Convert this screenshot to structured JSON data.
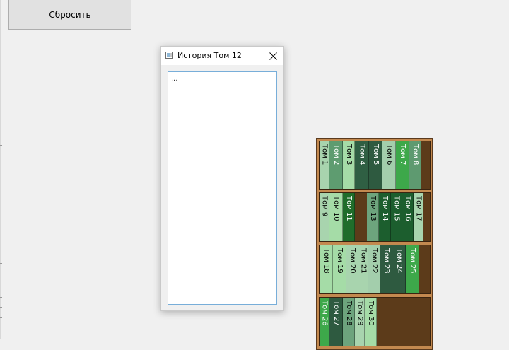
{
  "reset_button": {
    "label": "Сбросить"
  },
  "dialog": {
    "title": "История Том 12",
    "text": "..."
  },
  "colors": {
    "dark": "#2e6f47",
    "darkest": "#1c5e2e",
    "mid": "#3aa24a",
    "light": "#a5d5ad",
    "wood": "#5c3b1a",
    "frame": "#c3894f"
  },
  "shelves": [
    {
      "books": [
        {
          "label": "Том 1",
          "color": "#a8d4ae"
        },
        {
          "label": "Том 2",
          "color": "#5e9c70"
        },
        {
          "label": "Том 3",
          "color": "#a5dca7"
        },
        {
          "label": "Том 4",
          "color": "#2f5f43"
        },
        {
          "label": "Том 5",
          "color": "#2e5a40"
        },
        {
          "label": "Том 6",
          "color": "#a3ceac"
        },
        {
          "label": "Том 7",
          "color": "#3da84a"
        },
        {
          "label": "Том 8",
          "color": "#5e9a70"
        }
      ]
    },
    {
      "books": [
        {
          "label": "Том 9",
          "color": "#a8d4ae"
        },
        {
          "label": "Том 10",
          "color": "#a5dca7"
        },
        {
          "label": "Том 11",
          "color": "#1f6d2b"
        },
        {
          "label": "Том 13",
          "color": "#6da47d"
        },
        {
          "label": "Том 14",
          "color": "#1c5e2e"
        },
        {
          "label": "Том 15",
          "color": "#1c5e2e"
        },
        {
          "label": "Том 16",
          "color": "#1c5e2e"
        },
        {
          "label": "Том 17",
          "color": "#a8d4ae"
        }
      ]
    },
    {
      "books": [
        {
          "label": "Том 18",
          "color": "#a5dca7"
        },
        {
          "label": "Том 19",
          "color": "#a5dca7"
        },
        {
          "label": "Том 20",
          "color": "#a8d4ae"
        },
        {
          "label": "Том 21",
          "color": "#a8d4ae"
        },
        {
          "label": "Том 22",
          "color": "#a3ceac"
        },
        {
          "label": "Том 23",
          "color": "#2e5a40"
        },
        {
          "label": "Том 24",
          "color": "#2e5a40"
        },
        {
          "label": "Том 25",
          "color": "#3da84a"
        }
      ]
    },
    {
      "books": [
        {
          "label": "Том 26",
          "color": "#3da84a"
        },
        {
          "label": "Том 27",
          "color": "#2e5a40"
        },
        {
          "label": "Том 28",
          "color": "#6da47d"
        },
        {
          "label": "Том 29",
          "color": "#a8d4ae"
        },
        {
          "label": "Том 30",
          "color": "#a5dca7"
        }
      ]
    }
  ]
}
